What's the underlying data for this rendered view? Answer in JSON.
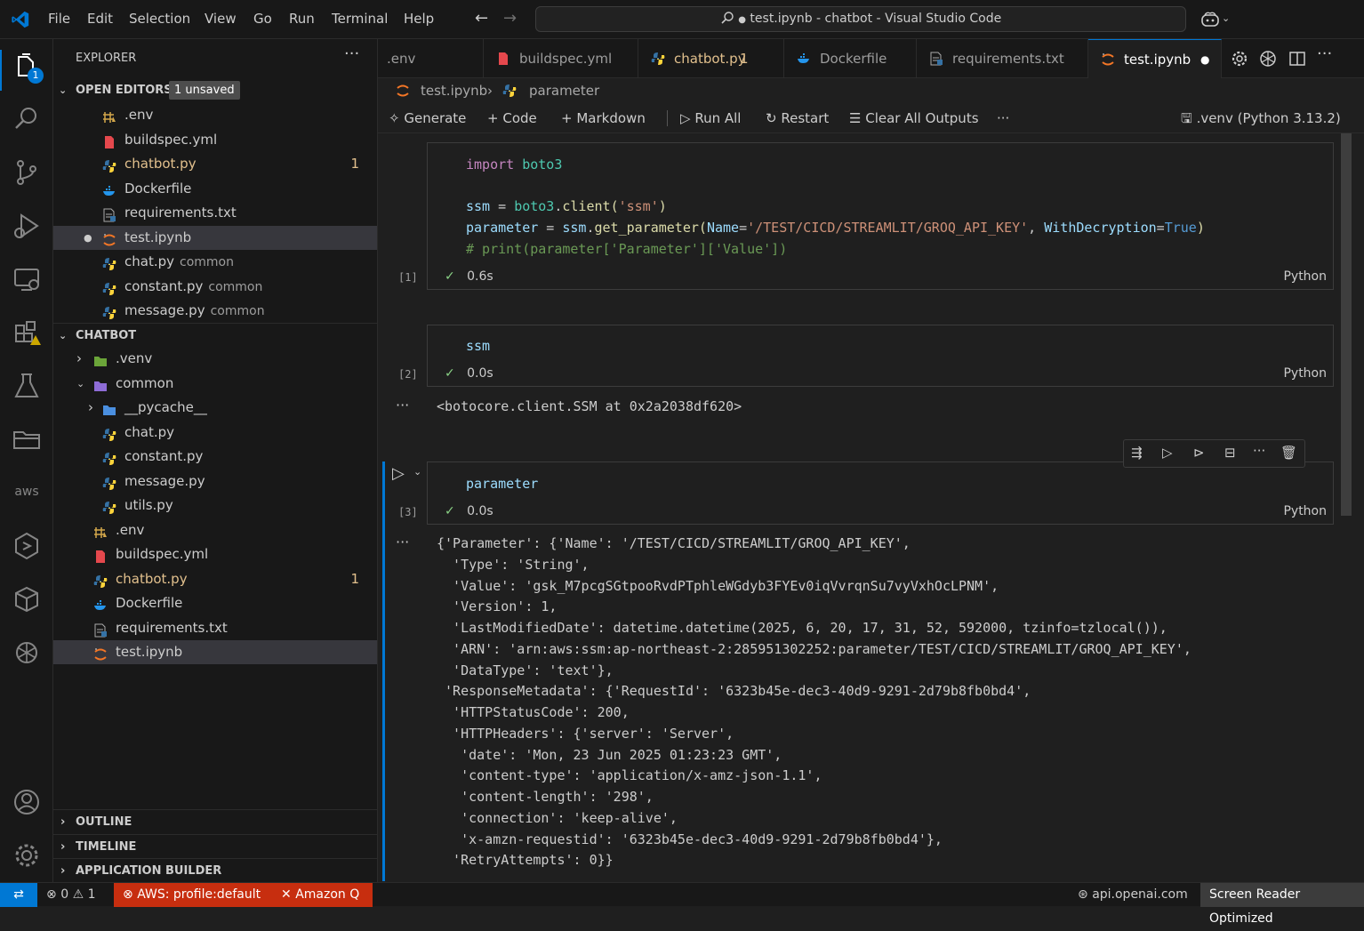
{
  "menu": [
    "File",
    "Edit",
    "Selection",
    "View",
    "Go",
    "Run",
    "Terminal",
    "Help"
  ],
  "command_center": "test.ipynb - chatbot - Visual Studio Code",
  "activity": {
    "explorer_badge": "1"
  },
  "sidebar": {
    "title": "EXPLORER",
    "open_editors": {
      "label": "OPEN EDITORS",
      "badge": "1 unsaved",
      "items": [
        {
          "name": ".env",
          "icon": "env-icon"
        },
        {
          "name": "buildspec.yml",
          "icon": "yaml-icon"
        },
        {
          "name": "chatbot.py",
          "icon": "python-icon",
          "count": "1"
        },
        {
          "name": "Dockerfile",
          "icon": "docker-icon"
        },
        {
          "name": "requirements.txt",
          "icon": "text-file-icon"
        },
        {
          "name": "test.ipynb",
          "icon": "notebook-icon"
        },
        {
          "name": "chat.py",
          "desc": "common",
          "icon": "python-icon"
        },
        {
          "name": "constant.py",
          "desc": "common",
          "icon": "python-icon"
        },
        {
          "name": "message.py",
          "desc": "common",
          "icon": "python-icon"
        }
      ]
    },
    "folder": {
      "label": "CHATBOT",
      "items": [
        {
          "name": ".venv",
          "type": "folder-closed"
        },
        {
          "name": "common",
          "type": "folder-open"
        },
        {
          "name": "__pycache__",
          "type": "folder-closed"
        },
        {
          "name": "chat.py"
        },
        {
          "name": "constant.py"
        },
        {
          "name": "message.py"
        },
        {
          "name": "utils.py"
        },
        {
          "name": ".env"
        },
        {
          "name": "buildspec.yml"
        },
        {
          "name": "chatbot.py",
          "count": "1"
        },
        {
          "name": "Dockerfile"
        },
        {
          "name": "requirements.txt"
        },
        {
          "name": "test.ipynb"
        }
      ]
    },
    "outline": "OUTLINE",
    "timeline": "TIMELINE",
    "app_builder": "APPLICATION BUILDER"
  },
  "tabs": [
    {
      "label": ".env"
    },
    {
      "label": "buildspec.yml"
    },
    {
      "label": "chatbot.py",
      "count": "1"
    },
    {
      "label": "Dockerfile"
    },
    {
      "label": "requirements.txt"
    },
    {
      "label": "test.ipynb",
      "active": true
    }
  ],
  "breadcrumb": [
    "test.ipynb",
    "parameter"
  ],
  "toolbar": {
    "generate": "Generate",
    "code": "Code",
    "markdown": "Markdown",
    "run_all": "Run All",
    "restart": "Restart",
    "clear": "Clear All Outputs",
    "kernel": ".venv (Python 3.13.2)"
  },
  "cells": [
    {
      "exec": "[1]",
      "time": "0.6s",
      "lang": "Python",
      "code": {
        "l1a": "import",
        "l1b": "boto3",
        "l3a": "ssm",
        "l3b": " = ",
        "l3c": "boto3",
        "l3d": ".",
        "l3e": "client",
        "l3f": "(",
        "l3g": "'ssm'",
        "l3h": ")",
        "l4a": "parameter",
        "l4b": " = ",
        "l4c": "ssm",
        "l4d": ".",
        "l4e": "get_parameter",
        "l4f": "(",
        "l4g": "Name",
        "l4h": "=",
        "l4i": "'/TEST/CICD/STREAMLIT/GROQ_API_KEY'",
        "l4j": ", ",
        "l4k": "WithDecryption",
        "l4l": "=",
        "l4m": "True",
        "l4n": ")",
        "l5": "# print(parameter['Parameter']['Value'])"
      }
    },
    {
      "exec": "[2]",
      "time": "0.0s",
      "lang": "Python",
      "code": "ssm",
      "output": "<botocore.client.SSM at 0x2a2038df620>"
    },
    {
      "exec": "[3]",
      "time": "0.0s",
      "lang": "Python",
      "code": "parameter",
      "output": "{'Parameter': {'Name': '/TEST/CICD/STREAMLIT/GROQ_API_KEY',\n  'Type': 'String',\n  'Value': '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',\n  'Version': 1,\n  'LastModifiedDate': datetime.datetime(2025, 6, 20, 17, 31, 52, 592000, tzinfo=tzlocal()),\n  'ARN': 'arn:aws:ssm:ap-northeast-2:285951302252:parameter/TEST/CICD/STREAMLIT/GROQ_API_KEY',\n  'DataType': 'text'},\n 'ResponseMetadata': {'RequestId': '6323b45e-dec3-40d9-9291-2d79b8fb0bd4',\n  'HTTPStatusCode': 200,\n  'HTTPHeaders': {'server': 'Server',\n   'date': 'Mon, 23 Jun 2025 01:23:23 GMT',\n   'content-type': 'application/x-amz-json-1.1',\n   'content-length': '298',\n   'connection': 'keep-alive',\n   'x-amzn-requestid': '6323b45e-dec3-40d9-9291-2d79b8fb0bd4'},\n  'RetryAttempts': 0}}"
    }
  ],
  "statusbar": {
    "errors": "0",
    "warnings": "1",
    "aws": "AWS: profile:default",
    "amazonq": "Amazon Q",
    "openai": "api.openai.com",
    "reader": "Screen Reader Optimized"
  }
}
